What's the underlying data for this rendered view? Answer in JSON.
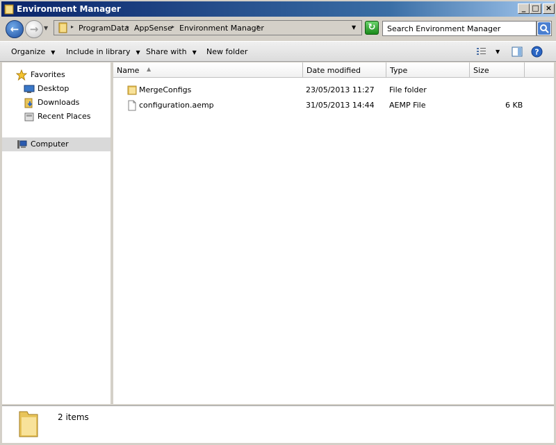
{
  "window": {
    "title": "Environment Manager"
  },
  "address": {
    "crumbs": [
      "ProgramData",
      "AppSense",
      "Environment Manager"
    ]
  },
  "search": {
    "placeholder": "Search Environment Manager"
  },
  "toolbar": {
    "organize": "Organize",
    "include_in_library": "Include in library",
    "share_with": "Share with",
    "new_folder": "New folder"
  },
  "nav": {
    "favorites": "Favorites",
    "desktop": "Desktop",
    "downloads": "Downloads",
    "recent_places": "Recent Places",
    "computer": "Computer"
  },
  "columns": {
    "name": "Name",
    "date_modified": "Date modified",
    "type": "Type",
    "size": "Size"
  },
  "files": [
    {
      "name": "MergeConfigs",
      "date": "23/05/2013 11:27",
      "type": "File folder",
      "size": "",
      "icon": "folder-icon"
    },
    {
      "name": "configuration.aemp",
      "date": "31/05/2013 14:44",
      "type": "AEMP File",
      "size": "6 KB",
      "icon": "file-icon"
    }
  ],
  "status": {
    "item_count": "2 items"
  }
}
